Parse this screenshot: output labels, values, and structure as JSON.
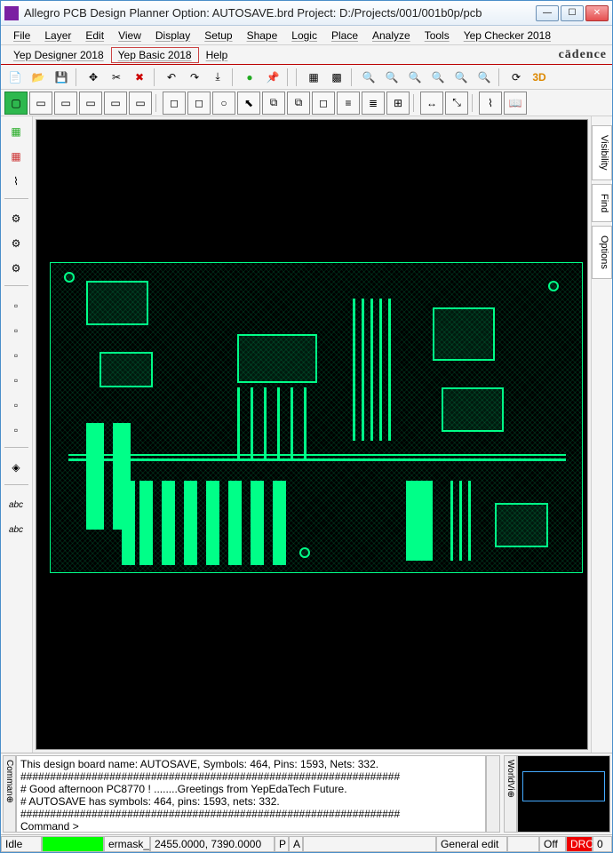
{
  "title": "Allegro PCB Design Planner Option: AUTOSAVE.brd  Project: D:/Projects/001/001b0p/pcb",
  "brand": "cādence",
  "menu_row1": [
    "File",
    "Layer",
    "Edit",
    "View",
    "Display",
    "Setup",
    "Shape",
    "Logic",
    "Place",
    "Analyze",
    "Tools",
    "Yep Checker 2018"
  ],
  "menu_row2": [
    "Yep Designer 2018",
    "Yep Basic 2018",
    "Help"
  ],
  "menu_row2_boxed_index": 1,
  "right_tabs": [
    "Visibility",
    "Find",
    "Options"
  ],
  "console_lines": [
    "This design board name: AUTOSAVE, Symbols: 464, Pins: 1593, Nets: 332.",
    "################################################################",
    "#  Good afternoon PC8770 !        ........Greetings from YepEdaTech Future.",
    "#  AUTOSAVE has symbols: 464, pins: 1593, nets: 332.",
    "################################################################",
    "Command >"
  ],
  "console_tab": "Comman⊕",
  "worldview_tab": "WorldVi⊕",
  "status": {
    "mode": "Idle",
    "layer_field": "ermask_",
    "coords": "2455.0000, 7390.0000",
    "p": "P",
    "a": "A",
    "edit_mode": "General edit",
    "onoff": "Off",
    "drc": "DRC",
    "count": "0"
  },
  "toolbar_icons": [
    "new",
    "open",
    "save",
    "sep",
    "move",
    "cut",
    "delete",
    "sep",
    "undo",
    "redo",
    "down",
    "sep",
    "sphere",
    "pin",
    "sep",
    "sep",
    "grid1",
    "grid2",
    "sep",
    "zoom-fit",
    "zoom-in",
    "zoom-out",
    "zoom-world",
    "zoom-prev",
    "zoom-sel",
    "sep",
    "refresh",
    "3d"
  ],
  "toolbar2_icons": [
    "extents-green",
    "rect1",
    "rect2",
    "rect3",
    "rect4",
    "rect5",
    "sep",
    "sq1",
    "sq2",
    "circle",
    "arrow",
    "copy1",
    "copy2",
    "sq3",
    "align1",
    "align2",
    "grp",
    "sep",
    "dim-h",
    "dim-diag",
    "sep",
    "route",
    "book"
  ],
  "left_icons": [
    "comp-green",
    "comp-red",
    "comp-wire",
    "sep",
    "tool-a",
    "tool-b",
    "tool-c",
    "sep",
    "g1",
    "g2",
    "g3",
    "g4",
    "g5",
    "g6",
    "sep",
    "conn",
    "sep",
    "txt-abc",
    "txt-abc2"
  ]
}
